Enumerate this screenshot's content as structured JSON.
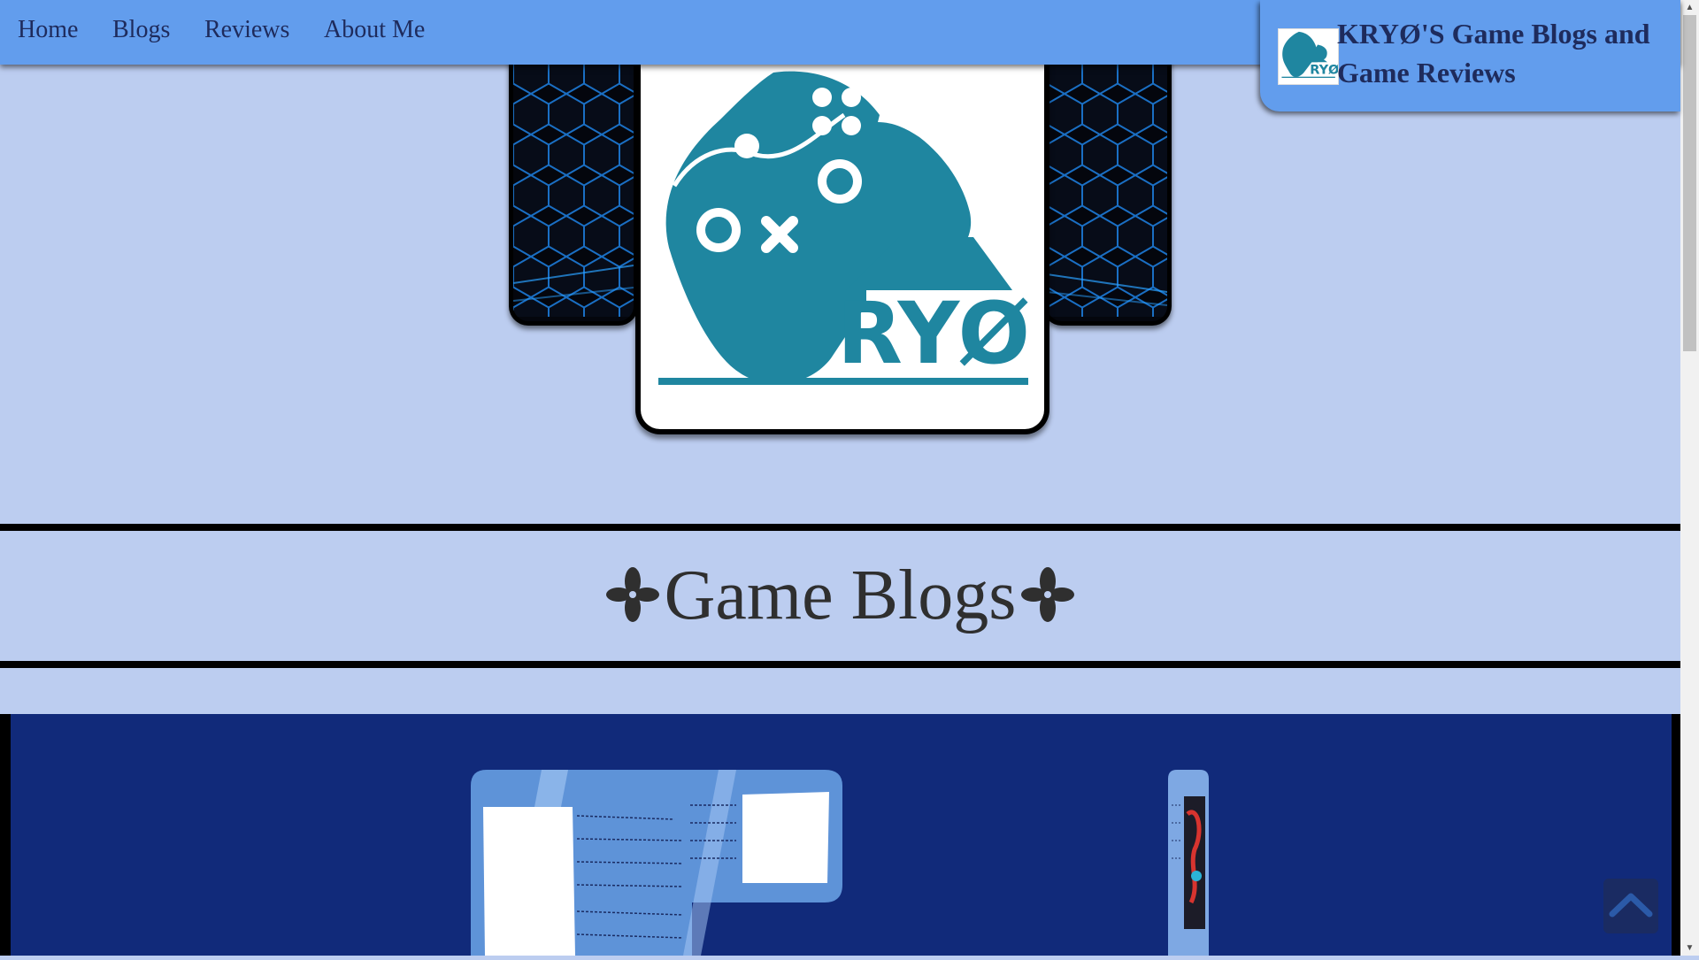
{
  "nav": {
    "links": [
      "Home",
      "Blogs",
      "Reviews",
      "About Me"
    ]
  },
  "brand": {
    "title": "KRYØ'S Game Blogs and Game Reviews",
    "logo_text": "RYØ"
  },
  "hero": {
    "logo_text": "RYØ"
  },
  "section": {
    "title": "Game Blogs"
  },
  "colors": {
    "nav_bg": "#629ded",
    "page_bg": "#bccdf0",
    "logo_teal": "#1f86a0",
    "blog_bg": "#112a7a",
    "text_dark": "#1e2b5c"
  },
  "icons": {
    "flower": "four-petal-flower-icon",
    "back_to_top": "chevron-up-icon",
    "logo": "gamepad-logo-icon"
  }
}
